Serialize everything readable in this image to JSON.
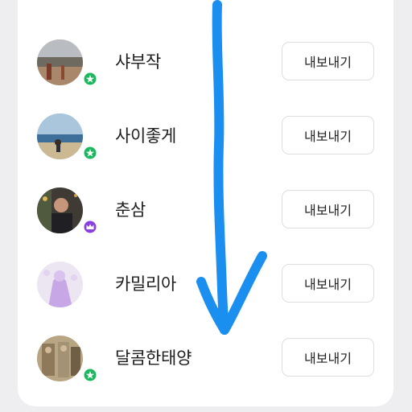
{
  "list": {
    "export_label": "내보내기",
    "items": [
      {
        "name": "샤부작",
        "badge": "green-star-badge",
        "badge_color": "#1bb85f"
      },
      {
        "name": "사이좋게",
        "badge": "green-star-badge",
        "badge_color": "#1bb85f"
      },
      {
        "name": "춘삼",
        "badge": "purple-crown-badge",
        "badge_color": "#8a3fe0"
      },
      {
        "name": "카밀리아",
        "badge": "none",
        "badge_color": ""
      },
      {
        "name": "달콤한태양",
        "badge": "green-star-badge",
        "badge_color": "#1bb85f"
      }
    ]
  },
  "colors": {
    "background": "#eeeef0",
    "card": "#ffffff",
    "button_border": "#dedee2",
    "annotation_arrow": "#1a8ff0"
  },
  "annotation": {
    "type": "hand-drawn-down-arrow"
  }
}
